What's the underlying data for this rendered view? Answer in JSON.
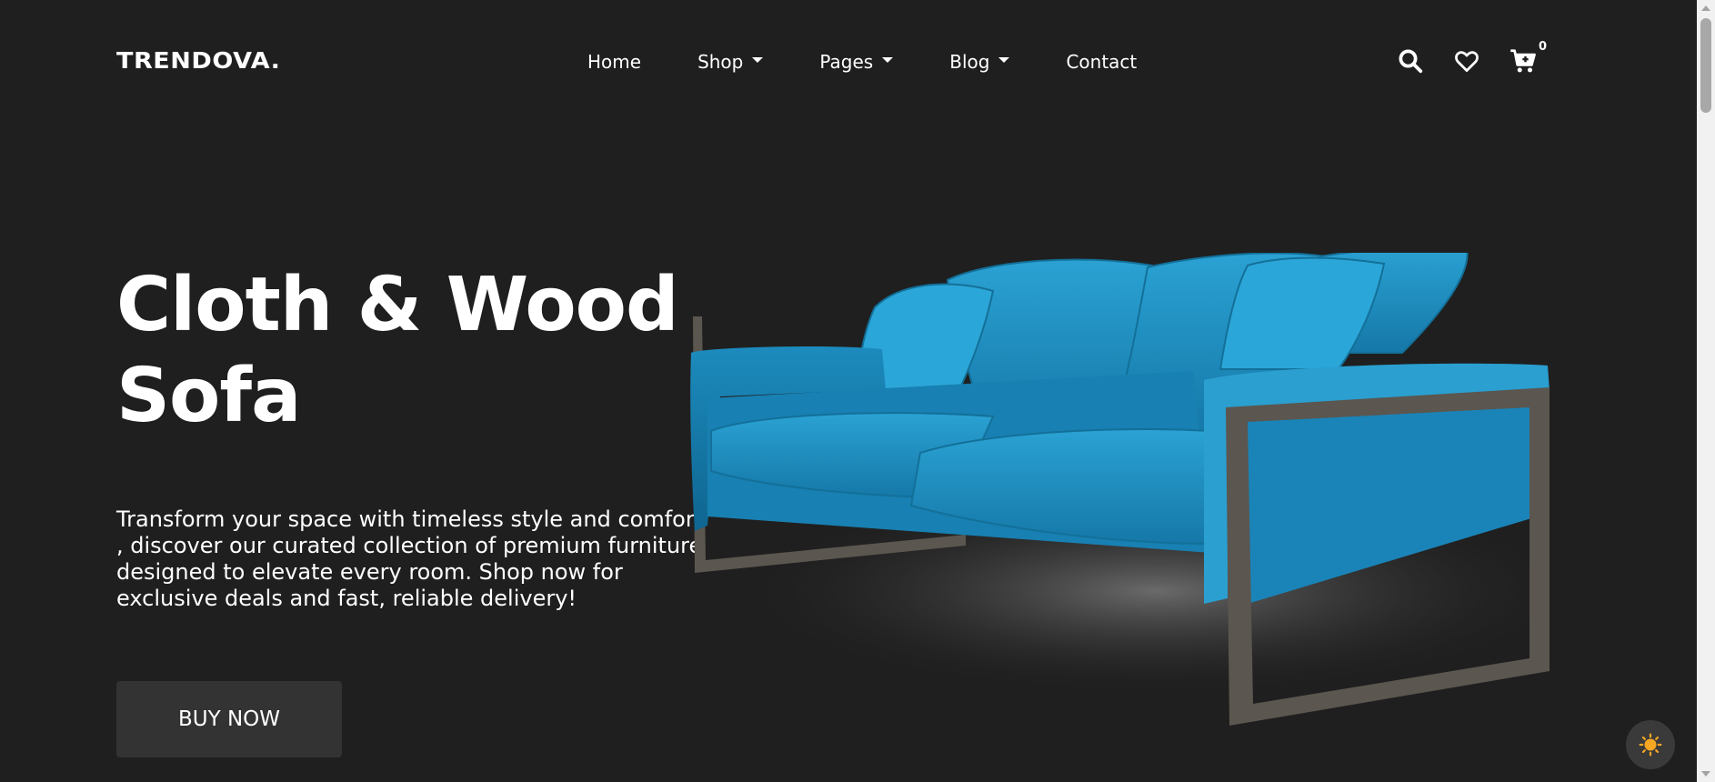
{
  "brand": {
    "logo_text": "TRENDOVA."
  },
  "nav": {
    "items": [
      {
        "label": "Home",
        "has_dropdown": false
      },
      {
        "label": "Shop",
        "has_dropdown": true
      },
      {
        "label": "Pages",
        "has_dropdown": true
      },
      {
        "label": "Blog",
        "has_dropdown": true
      },
      {
        "label": "Contact",
        "has_dropdown": false
      }
    ]
  },
  "header_icons": {
    "search": "search-icon",
    "wishlist": "heart-icon",
    "cart": "cart-icon",
    "cart_count": "0"
  },
  "hero": {
    "title_line1": "Cloth & Wood",
    "title_line2": "Sofa",
    "description": "Transform your space with timeless style and comfort , discover our curated collection of premium furniture designed to elevate every room. Shop now for exclusive deals and fast, reliable delivery!",
    "cta_label": "BUY NOW",
    "image": "blue-sofa-image"
  },
  "theme_toggle": {
    "icon": "sun-icon"
  },
  "colors": {
    "background": "#1f1f1f",
    "text": "#ffffff",
    "button": "#333333",
    "sofa": "#1f8fc1",
    "toggle_sun": "#f5a623"
  }
}
